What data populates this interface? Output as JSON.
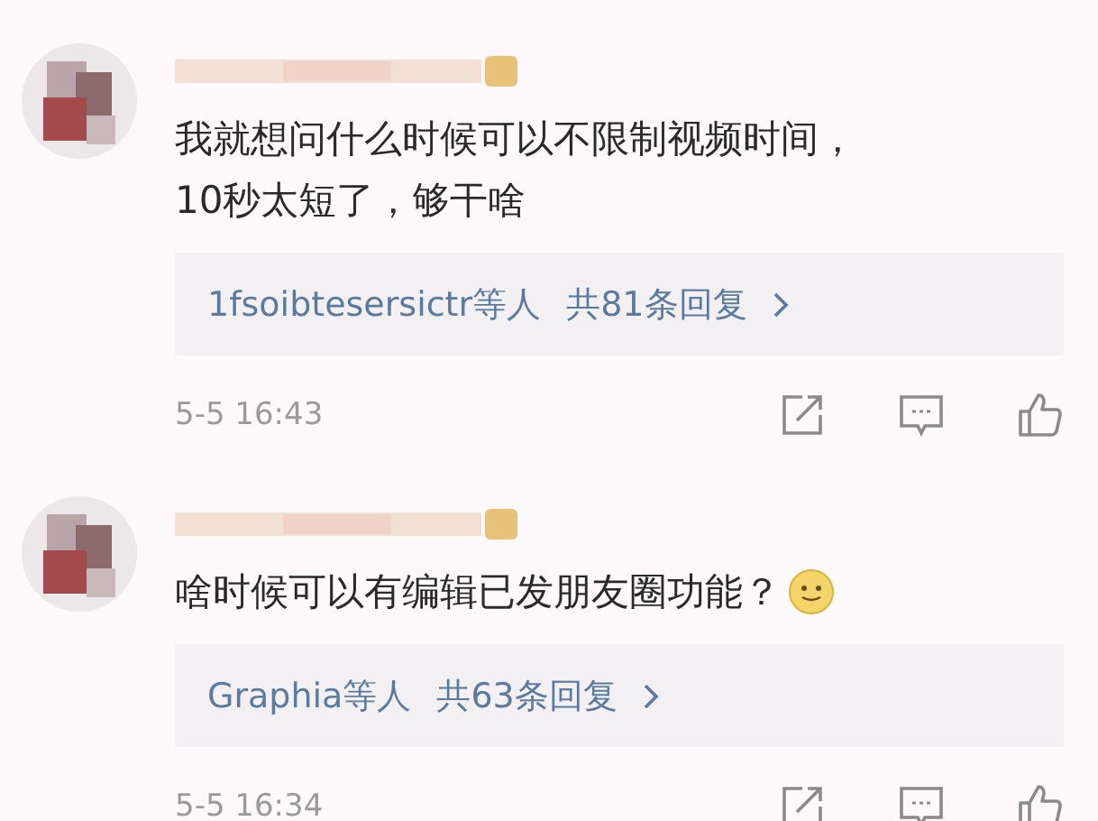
{
  "comments": [
    {
      "avatar": {
        "kind": "picture"
      },
      "author": {
        "kind": "blurred"
      },
      "lines": [
        "我就想问什么时候可以不限制视频时间，",
        "10秒太短了，够干啥"
      ],
      "replies": {
        "names": "1fsoibtesersictr等人",
        "count": "共81条回复"
      },
      "time": "5-5 16:43"
    },
    {
      "avatar": {
        "kind": "picture"
      },
      "author": {
        "kind": "blurred"
      },
      "lines": [
        "啥时候可以有编辑已发朋友圈功能？"
      ],
      "emoji": {
        "kind": "smile"
      },
      "replies": {
        "names": "Graphia等人",
        "count": "共63条回复"
      },
      "time": "5-5 16:34"
    }
  ]
}
